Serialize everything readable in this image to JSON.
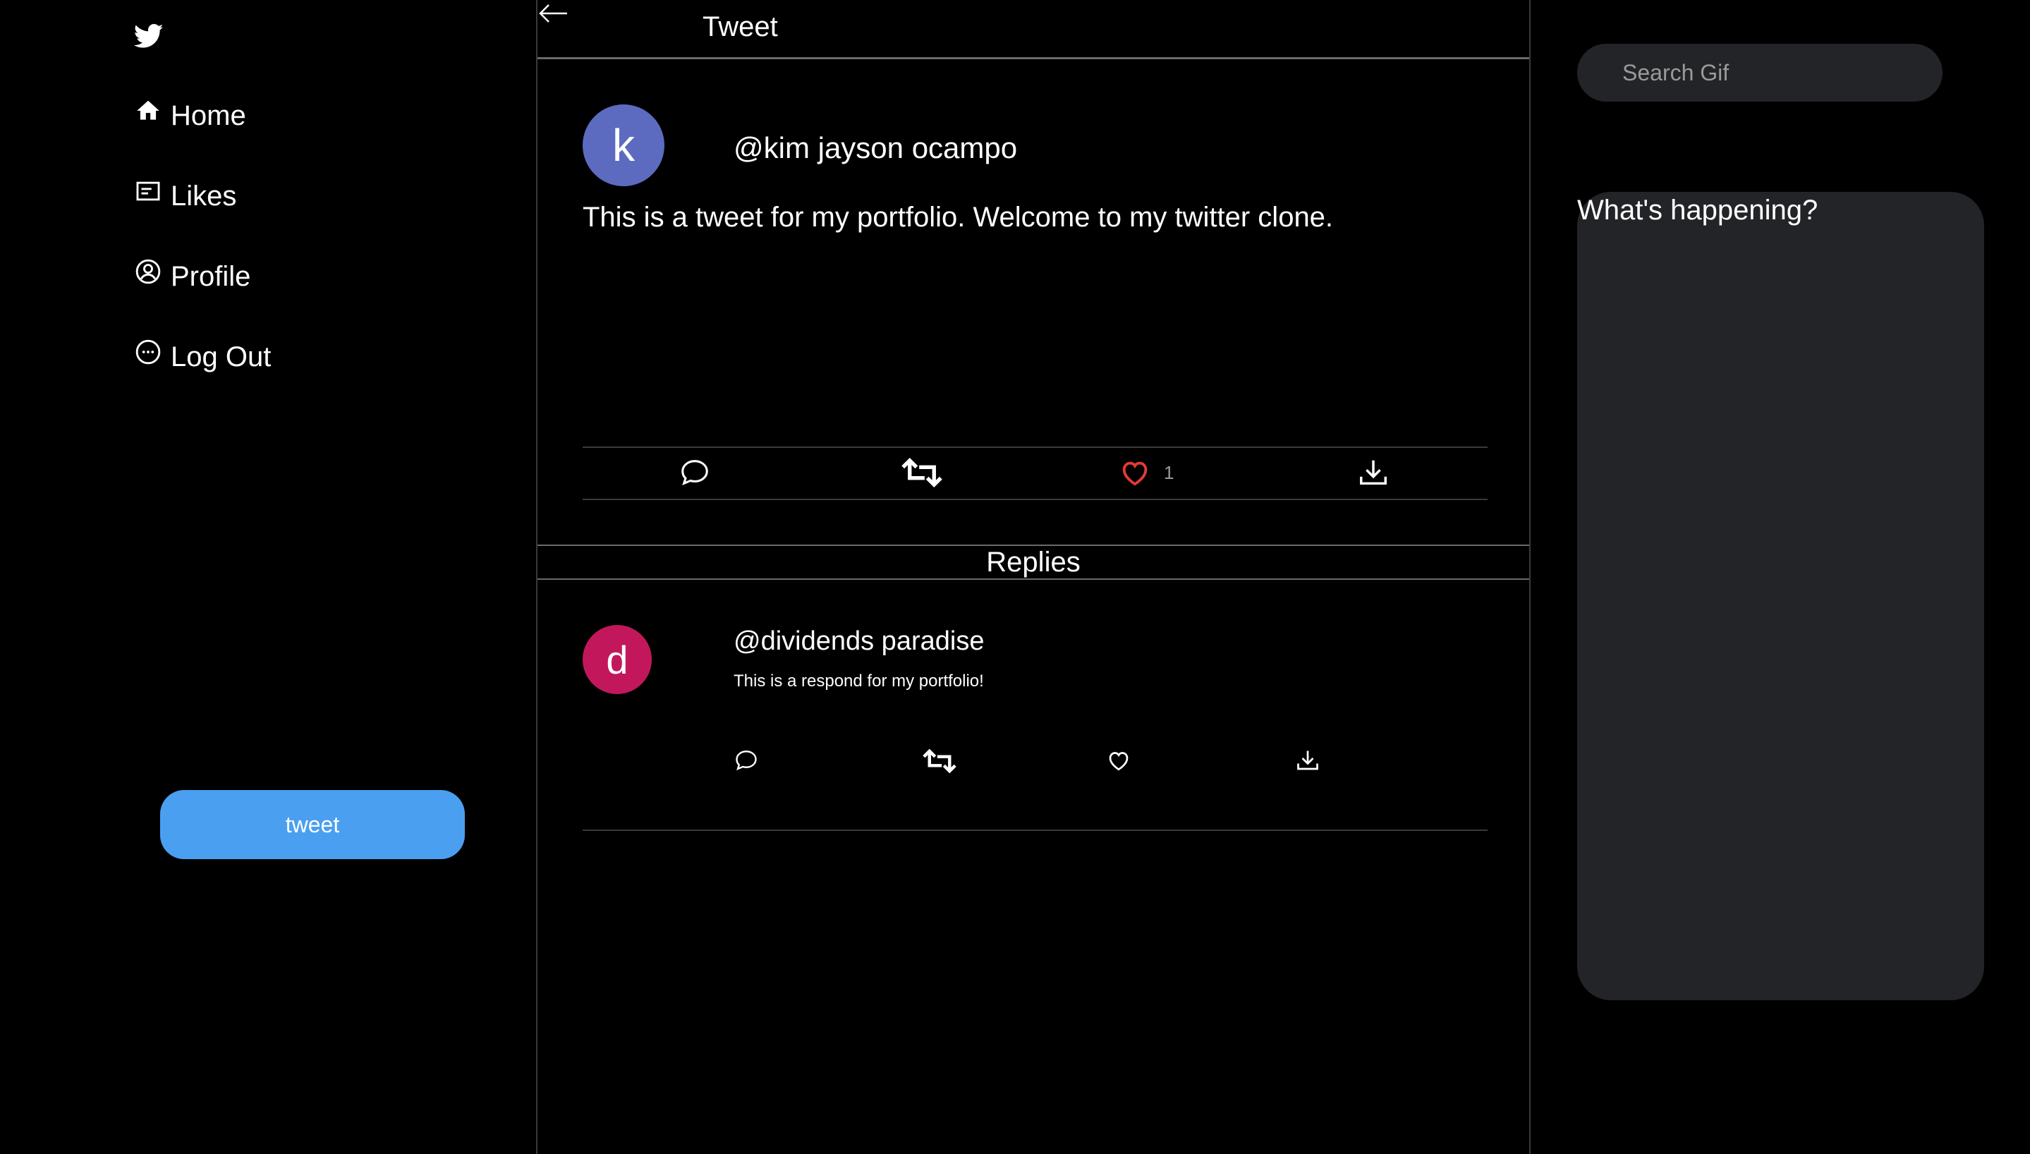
{
  "nav": {
    "home": "Home",
    "likes": "Likes",
    "profile": "Profile",
    "logout": "Log Out",
    "tweet_button": "tweet"
  },
  "header": {
    "title": "Tweet"
  },
  "tweet": {
    "avatar_letter": "k",
    "handle": "@kim jayson ocampo",
    "text": "This is a tweet for my portfolio. Welcome to my twitter clone.",
    "like_count": "1"
  },
  "replies": {
    "title": "Replies",
    "items": [
      {
        "avatar_letter": "d",
        "handle": "@dividends paradise",
        "text": "This is a respond for my portfolio!"
      }
    ]
  },
  "sidebar": {
    "search_placeholder": "Search Gif",
    "happening_title": "What's happening?"
  },
  "colors": {
    "accent": "#4a9ff0",
    "like_active": "#e53935",
    "avatar_k": "#5c6bc0",
    "avatar_d": "#c2185b",
    "panel": "#232427"
  },
  "icons": [
    "twitter-logo-icon",
    "home-icon",
    "likes-list-icon",
    "profile-icon",
    "logout-icon",
    "back-arrow-icon",
    "comment-icon",
    "retweet-icon",
    "heart-icon",
    "download-icon"
  ]
}
